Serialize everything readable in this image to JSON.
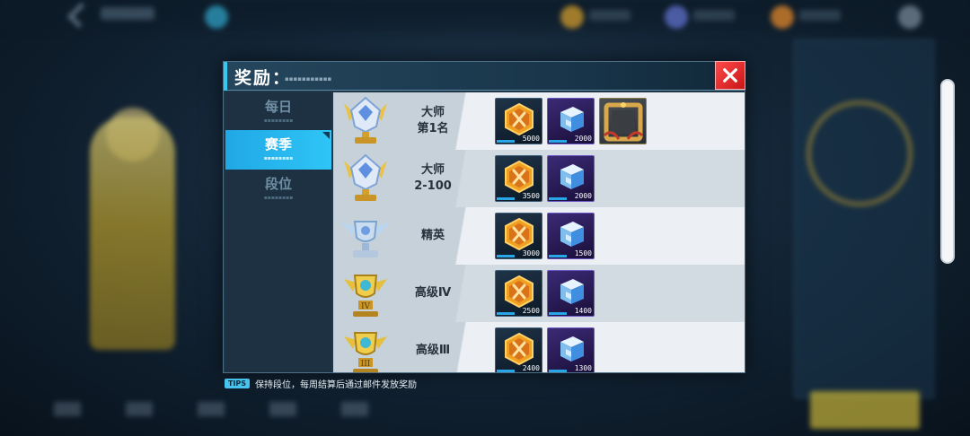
{
  "dialog": {
    "title": "奖励：",
    "close_icon": "close-icon"
  },
  "tabs": [
    {
      "label": "每日",
      "active": false
    },
    {
      "label": "赛季",
      "active": true
    },
    {
      "label": "段位",
      "active": false
    }
  ],
  "rewards": [
    {
      "rank_line1": "大师",
      "rank_line2": "第1名",
      "trophy": "gold-diamond-trophy-icon",
      "items": [
        {
          "type": "coin",
          "qty": "5000"
        },
        {
          "type": "cube",
          "qty": "2000"
        },
        {
          "type": "frame",
          "qty": ""
        }
      ]
    },
    {
      "rank_line1": "大师",
      "rank_line2": "2-100",
      "trophy": "gold-diamond-trophy-icon",
      "items": [
        {
          "type": "coin",
          "qty": "3500"
        },
        {
          "type": "cube",
          "qty": "2000"
        }
      ]
    },
    {
      "rank_line1": "精英",
      "rank_line2": "",
      "trophy": "silver-winged-trophy-icon",
      "items": [
        {
          "type": "coin",
          "qty": "3000"
        },
        {
          "type": "cube",
          "qty": "1500"
        }
      ]
    },
    {
      "rank_line1": "高级Ⅳ",
      "rank_line2": "",
      "trophy": "gold-trophy-iv-icon",
      "items": [
        {
          "type": "coin",
          "qty": "2500"
        },
        {
          "type": "cube",
          "qty": "1400"
        }
      ]
    },
    {
      "rank_line1": "高级Ⅲ",
      "rank_line2": "",
      "trophy": "gold-trophy-iii-icon",
      "items": [
        {
          "type": "coin",
          "qty": "2400"
        },
        {
          "type": "cube",
          "qty": "1300"
        }
      ]
    }
  ],
  "tips": {
    "badge": "TIPS",
    "text": "保持段位，每周结算后通过邮件发放奖励"
  },
  "colors": {
    "accent": "#2fc5f6",
    "close": "#e02020",
    "gold": "#e0b43a"
  }
}
